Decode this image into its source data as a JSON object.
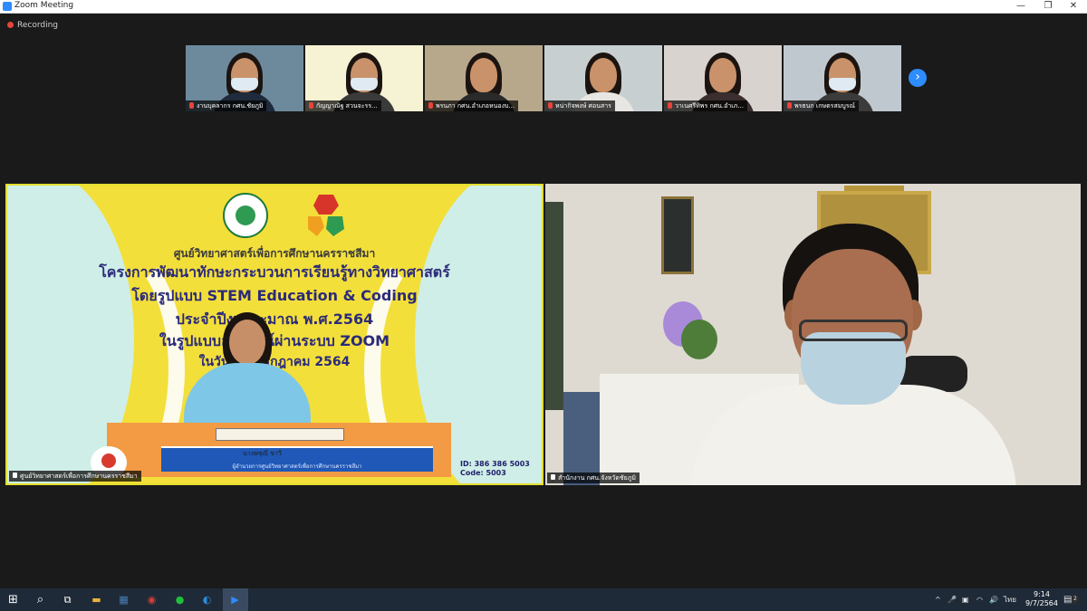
{
  "window": {
    "title": "Zoom Meeting",
    "minimize_glyph": "—",
    "restore_glyph": "❐",
    "close_glyph": "✕"
  },
  "recording": {
    "label": "Recording"
  },
  "participants": [
    {
      "name": "งานบุคลากร กศน.ชัยภูมิ",
      "body_color": "#1f2b3c",
      "bg": "#6d8a9c",
      "masked": true
    },
    {
      "name": "กัญญาณัฐ สวนจะรร...",
      "body_color": "#3a3a3a",
      "bg": "#f6f2d4",
      "masked": true
    },
    {
      "name": "พรนภา กศน.อำเภอหนองบ...",
      "body_color": "#2a2a2a",
      "bg": "#b7a88c",
      "masked": false
    },
    {
      "name": "หน่ากิจพงษ์ ศอนสาร",
      "body_color": "#e8e6e2",
      "bg": "#c8cfd0",
      "masked": false
    },
    {
      "name": "วาเนศรีทิพร กศน.อำเภ...",
      "body_color": "#3a2e2e",
      "bg": "#d9d3d0",
      "masked": false
    },
    {
      "name": "พรธนก เกษตรสมบูรณ์",
      "body_color": "#3b3b3b",
      "bg": "#c0c8cf",
      "masked": true
    }
  ],
  "nav": {
    "next_glyph": "›"
  },
  "left_video": {
    "slide": {
      "line1": "ศูนย์วิทยาศาสตร์เพื่อการศึกษานครราชสีมา",
      "line2": "โครงการพัฒนาทักษะกระบวนการเรียนรู้ทางวิทยาศาสตร์",
      "line3": "โดยรูปแบบ STEM Education & Coding",
      "line4": "ประจำปีงบประมาณ พ.ศ.2564",
      "line5": "ในรูปแบบออนไลน์ผ่านระบบ ZOOM",
      "line6": "ในวันที่ 9 กรกฎาคม 2564",
      "presenter_title": "นางพชุณี ชาวี",
      "presenter_name": "ผู้อำนวยการศูนย์วิทยาศาสตร์เพื่อการศึกษานครราชสีมา",
      "meeting_id": "ID: 386 386 5003",
      "passcode": "Code: 5003"
    },
    "name": "ศูนย์วิทยาศาสตร์เพื่อการศึกษานครราชสีมา",
    "highlight_color": "#e4df2f"
  },
  "right_video": {
    "name": "สำนักงาน กศน.จังหวัดชัยภูมิ"
  },
  "taskbar": {
    "start_glyph": "⊞",
    "search_glyph": "⌕",
    "taskview_glyph": "⧉",
    "apps": [
      {
        "name": "file-explorer-icon",
        "glyph": "▬",
        "color": "#e9b33c"
      },
      {
        "name": "calculator-icon",
        "glyph": "▦",
        "color": "#4a7fb5"
      },
      {
        "name": "chrome-icon",
        "glyph": "◉",
        "color": "#d93f34"
      },
      {
        "name": "line-icon",
        "glyph": "●",
        "color": "#1fbf3a"
      },
      {
        "name": "edge-icon",
        "glyph": "◐",
        "color": "#2a8bd8"
      },
      {
        "name": "zoom-icon",
        "glyph": "▶",
        "color": "#2d8cff"
      }
    ],
    "tray_chevron": "^",
    "tray_mic": "🎤",
    "tray_display": "▣",
    "tray_network": "◠",
    "tray_volume": "🔊",
    "language": "ไทย",
    "time": "9:14",
    "date": "9/7/2564",
    "notifications_glyph": "▤",
    "notification_count": "2"
  }
}
